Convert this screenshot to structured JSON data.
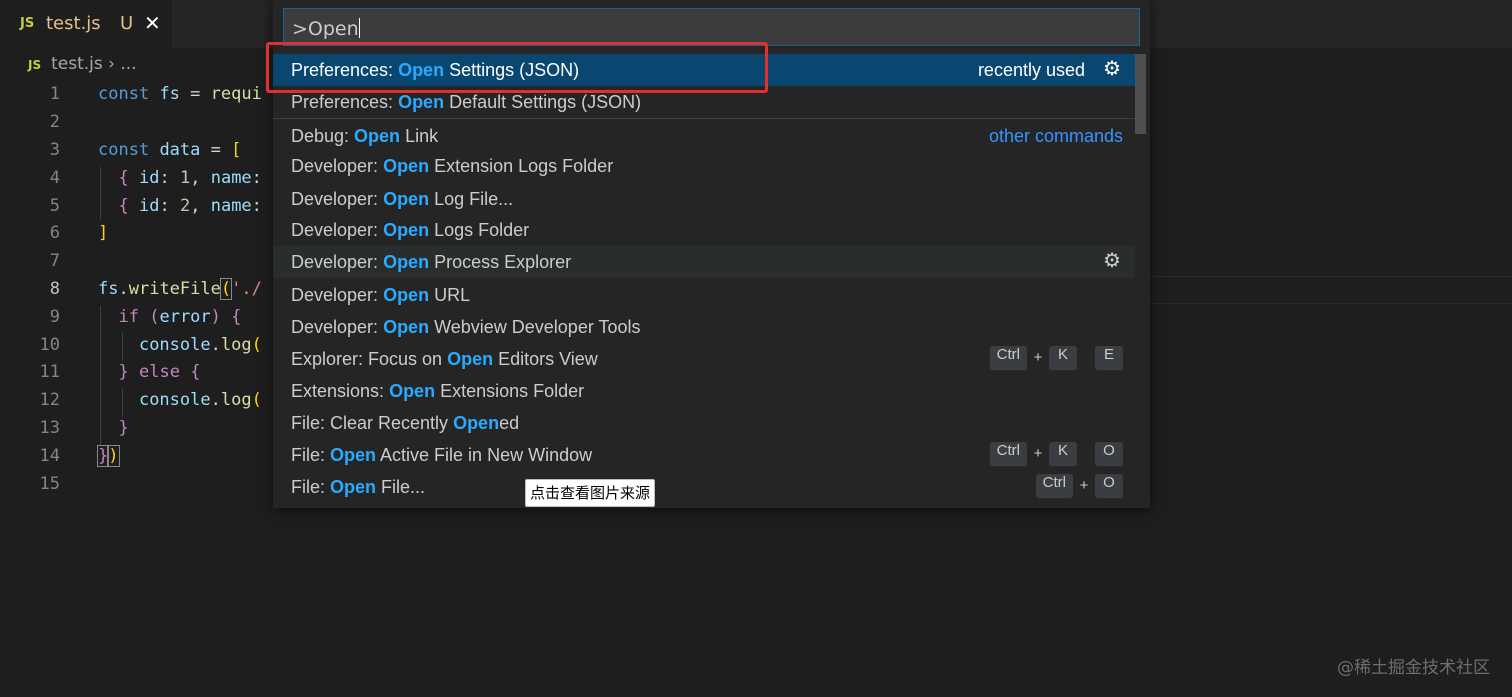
{
  "tab": {
    "icon": "JS",
    "filename": "test.js",
    "status": "U",
    "close": "✕"
  },
  "breadcrumb": {
    "icon": "JS",
    "file": "test.js",
    "sep": "›",
    "rest": "..."
  },
  "editor": {
    "line_numbers": [
      "1",
      "2",
      "3",
      "4",
      "5",
      "6",
      "7",
      "8",
      "9",
      "10",
      "11",
      "12",
      "13",
      "14",
      "15"
    ],
    "current_line": "8",
    "lines": {
      "l1": {
        "kw": "const",
        "var": "fs",
        "op": "=",
        "fn": "requi"
      },
      "l3": {
        "kw": "const",
        "var": "data",
        "op": "=",
        "br": "["
      },
      "l4": {
        "br": "{",
        "key": "id",
        "colon": ":",
        "num": "1",
        "comma": ",",
        "key2": "name",
        "colon2": ":"
      },
      "l5": {
        "br": "{",
        "key": "id",
        "colon": ":",
        "num": "2",
        "comma": ",",
        "key2": "name",
        "colon2": ":"
      },
      "l6": {
        "br": "]"
      },
      "l8": {
        "obj": "fs",
        "dot": ".",
        "fn": "writeFile",
        "paren": "(",
        "str": "'./"
      },
      "l9": {
        "kw": "if",
        "p1": "(",
        "var": "error",
        "p2": ")",
        "br": "{"
      },
      "l10": {
        "obj": "console",
        "dot": ".",
        "fn": "log",
        "paren": "("
      },
      "l11": {
        "br1": "}",
        "kw": "else",
        "br2": "{"
      },
      "l12": {
        "obj": "console",
        "dot": ".",
        "fn": "log",
        "paren": "("
      },
      "l13": {
        "br": "}"
      },
      "l14": {
        "br1": "}",
        "br2": ")"
      }
    }
  },
  "palette": {
    "input": ">Open",
    "items": [
      {
        "pre": "Preferences: ",
        "hl": "Open",
        "post": " Settings (JSON)",
        "right": "recently used",
        "gear": "⚙"
      },
      {
        "pre": "Preferences: ",
        "hl": "Open",
        "post": " Default Settings (JSON)"
      },
      {
        "pre": "Debug: ",
        "hl": "Open",
        "post": " Link",
        "right": "other commands"
      },
      {
        "pre": "Developer: ",
        "hl": "Open",
        "post": " Extension Logs Folder"
      },
      {
        "pre": "Developer: ",
        "hl": "Open",
        "post": " Log File..."
      },
      {
        "pre": "Developer: ",
        "hl": "Open",
        "post": " Logs Folder"
      },
      {
        "pre": "Developer: ",
        "hl": "Open",
        "post": " Process Explorer",
        "gear": "⚙"
      },
      {
        "pre": "Developer: ",
        "hl": "Open",
        "post": " URL"
      },
      {
        "pre": "Developer: ",
        "hl": "Open",
        "post": " Webview Developer Tools"
      },
      {
        "pre": "Explorer: Focus on ",
        "hl": "Open",
        "post": " Editors View",
        "keys": [
          "Ctrl",
          "+",
          "K",
          "E"
        ]
      },
      {
        "pre": "Extensions: ",
        "hl": "Open",
        "post": " Extensions Folder"
      },
      {
        "pre": "File: Clear Recently ",
        "hl": "Open",
        "post": "ed"
      },
      {
        "pre": "File: ",
        "hl": "Open",
        "post": " Active File in New Window",
        "keys": [
          "Ctrl",
          "+",
          "K",
          "O"
        ]
      },
      {
        "pre": "File: ",
        "hl": "Open",
        "post": " File...",
        "keys": [
          "Ctrl",
          "+",
          "O"
        ]
      }
    ]
  },
  "tooltip": "点击查看图片来源",
  "watermark": "@稀土掘金技术社区",
  "colors": {
    "highlight": "#2aaaff",
    "selected_bg": "#094771",
    "annotation_border": "#e03030"
  }
}
